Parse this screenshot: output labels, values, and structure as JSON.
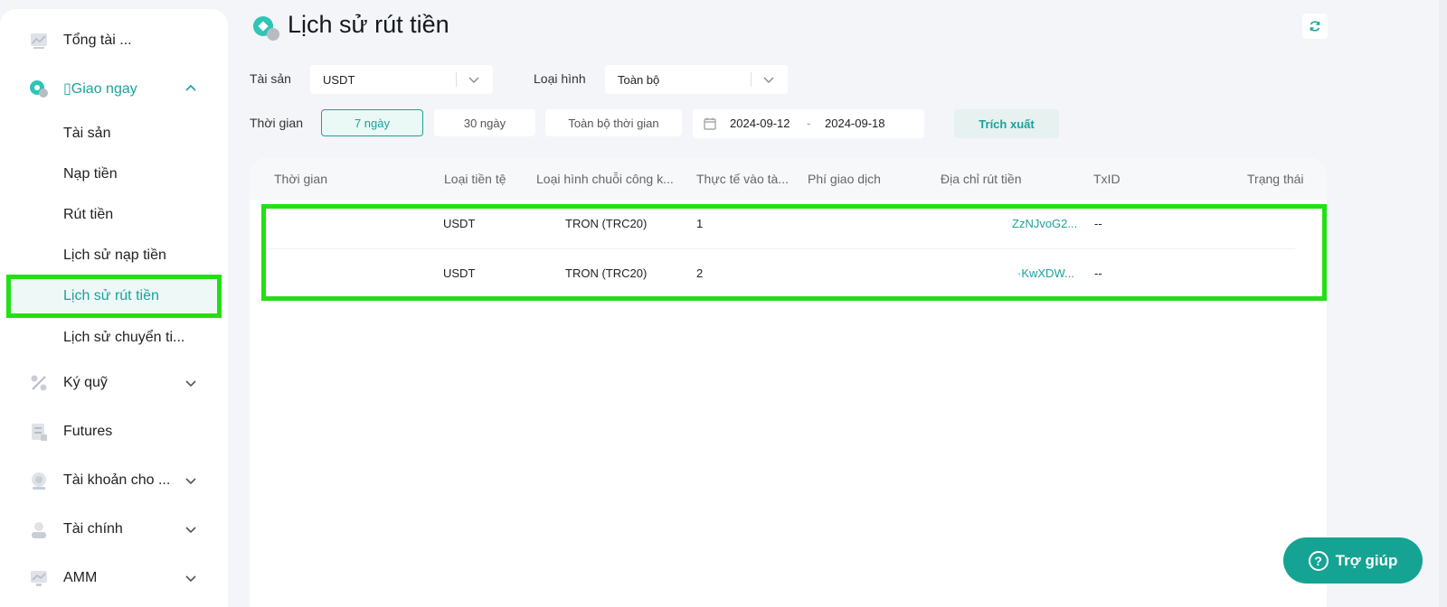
{
  "sidebar": {
    "items": [
      {
        "label": "Tổng tài ...",
        "icon": "chart-icon"
      },
      {
        "label": "▯Giao ngay",
        "icon": "spot-icon",
        "expanded": true
      },
      {
        "label": "Ký quỹ",
        "icon": "margin-icon"
      },
      {
        "label": "Futures",
        "icon": "futures-icon"
      },
      {
        "label": "Tài khoản cho ...",
        "icon": "account-icon"
      },
      {
        "label": "Tài chính",
        "icon": "finance-icon"
      },
      {
        "label": "AMM",
        "icon": "amm-icon"
      }
    ],
    "spot_sub": [
      {
        "label": "Tài sản"
      },
      {
        "label": "Nạp tiền"
      },
      {
        "label": "Rút tiền"
      },
      {
        "label": "Lịch sử nạp tiền"
      },
      {
        "label": "Lịch sử rút tiền",
        "active": true
      },
      {
        "label": "Lịch sử chuyển ti..."
      }
    ]
  },
  "header": {
    "title": "Lịch sử rút tiền"
  },
  "filters": {
    "asset_label": "Tài sản",
    "asset_value": "USDT",
    "type_label": "Loại hình",
    "type_value": "Toàn bộ",
    "time_label": "Thời gian",
    "time_options": [
      "7 ngày",
      "30 ngày",
      "Toàn bộ thời gian"
    ],
    "time_selected": "7 ngày",
    "date_start": "2024-09-12",
    "date_sep": "-",
    "date_end": "2024-09-18",
    "export_label": "Trích xuất"
  },
  "table": {
    "columns": [
      "Thời gian",
      "Loại tiền tệ",
      "Loại hình chuỗi công k...",
      "Thực tế vào tà...",
      "Phí giao dịch",
      "Địa chỉ rút tiền",
      "TxID",
      "Trạng thái"
    ],
    "rows": [
      {
        "time": "",
        "currency": "USDT",
        "chain": "TRON (TRC20)",
        "actual": "1",
        "fee": "",
        "address": "ZzNJvoG2...",
        "txid": "--",
        "status": ""
      },
      {
        "time": "",
        "currency": "USDT",
        "chain": "TRON (TRC20)",
        "actual": "2",
        "fee": "",
        "address": "·KwXDW...",
        "txid": "--",
        "status": ""
      }
    ]
  },
  "help": {
    "label": "Trợ giúp",
    "q": "?"
  },
  "colors": {
    "accent": "#1aa39a",
    "highlight": "#22e014",
    "help_bg": "#15a393"
  }
}
